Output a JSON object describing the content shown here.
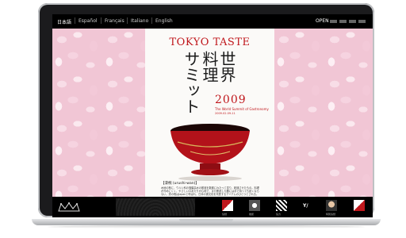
{
  "topbar": {
    "languages": [
      "日本語",
      "Español",
      "Français",
      "Italiano",
      "English"
    ],
    "open_label": "OPEN"
  },
  "poster": {
    "title": "TOKYO TASTE",
    "vertical_lines": [
      "世界",
      "料理",
      "サミット"
    ],
    "year": "2009",
    "subtitle": "The World Summit of Gastronomy",
    "date": "2009.02.09-11",
    "caption": "【漆椀 (urushi-wan)】",
    "description": "木地の椀に、ウルシ科の落葉高木の樹液を数層にわたって塗り、乾燥させたもの。料理が冷めにくく、やさしい口あたりが心地で、また断熱した器には手で持っても熱くならない。漆の椀はJapanと呼ばれ、日本の食文化を代表するアイテムのひとつとされる。"
  },
  "sponsors": [
    {
      "label": "協賛"
    },
    {
      "label": "後援"
    },
    {
      "label": "協力"
    },
    {
      "label": "特別協賛"
    }
  ],
  "colors": {
    "accent": "#c0171c",
    "petal": "#f1c6d5",
    "bar": "#000000"
  }
}
